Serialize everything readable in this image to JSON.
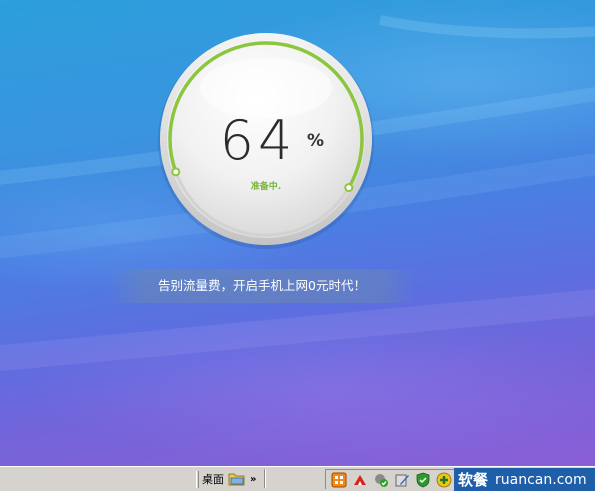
{
  "progress": {
    "percent": 64,
    "value_text": "64",
    "unit": "%",
    "status": "准备中."
  },
  "banner": {
    "slogan": "告别流量费，开启手机上网0元时代！"
  },
  "taskbar": {
    "desktop_label": "桌面",
    "chevron": "»"
  },
  "tray": {
    "icons": [
      "tray-app-icon",
      "tray-red-icon",
      "tray-shield-check-icon",
      "tray-pen-icon",
      "tray-shield-icon",
      "tray-plus-icon"
    ]
  },
  "watermark": {
    "brand_cn": "软餐",
    "brand_en": "ruancan.com"
  },
  "colors": {
    "accent_green": "#8cc63f",
    "status_green": "#7bb43a",
    "wallpaper_top": "#2c9fdc",
    "wallpaper_bottom": "#8b5fd6",
    "taskbar": "#d6d3ce",
    "watermark_bg": "#1f5faa"
  }
}
